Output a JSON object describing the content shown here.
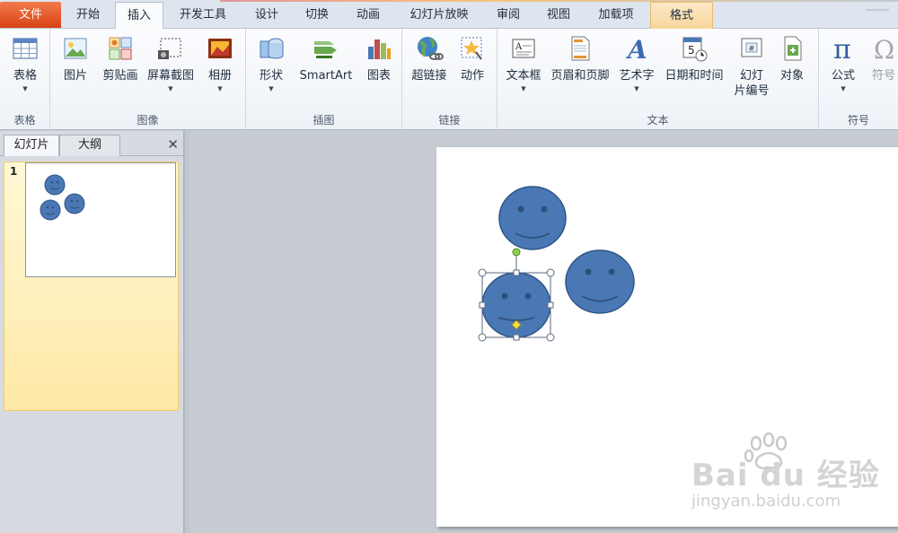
{
  "tabs": {
    "file": "文件",
    "home": "开始",
    "insert": "插入",
    "developer": "开发工具",
    "design": "设计",
    "transitions": "切换",
    "animations": "动画",
    "slideshow": "幻灯片放映",
    "review": "审阅",
    "view": "视图",
    "addins": "加载项",
    "format": "格式"
  },
  "ribbon": {
    "tables": {
      "group_label": "表格",
      "table": "表格"
    },
    "images": {
      "group_label": "图像",
      "picture": "图片",
      "clipart": "剪贴画",
      "screenshot": "屏幕截图",
      "album": "相册"
    },
    "illustrations": {
      "group_label": "插图",
      "shapes": "形状",
      "smartart": "SmartArt",
      "chart": "图表"
    },
    "links": {
      "group_label": "链接",
      "hyperlink": "超链接",
      "action": "动作"
    },
    "text": {
      "group_label": "文本",
      "textbox": "文本框",
      "header_footer": "页眉和页脚",
      "wordart": "艺术字",
      "datetime": "日期和时间",
      "slide_number_1": "幻灯",
      "slide_number_2": "片编号",
      "object": "对象"
    },
    "symbols": {
      "group_label": "符号",
      "equation": "公式",
      "symbol": "符号"
    }
  },
  "left_pane": {
    "tab_slides": "幻灯片",
    "tab_outline": "大纲",
    "close": "✕",
    "slide_number": "1"
  },
  "watermark": {
    "brand": "Bai du 经验",
    "url": "jingyan.baidu.com"
  },
  "colors": {
    "face_fill": "#4a78b5",
    "face_stroke": "#2e5587",
    "handle_rotate": "#8fd14f",
    "handle_adjust": "#f4e04d"
  }
}
